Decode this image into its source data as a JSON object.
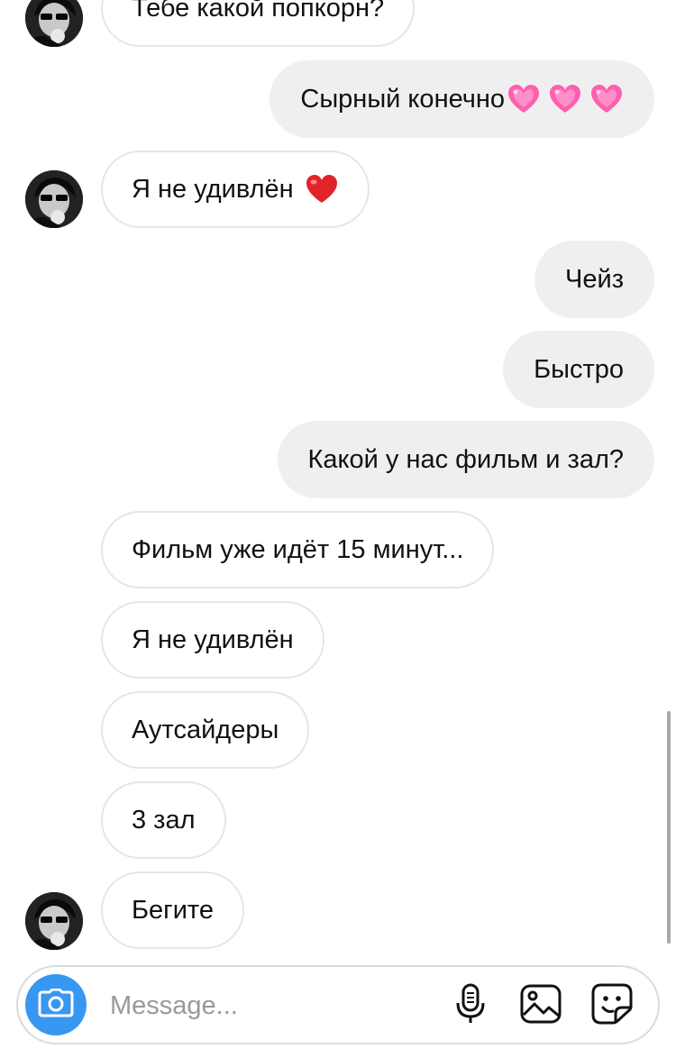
{
  "conversation": {
    "messages": [
      {
        "text": "Тебе какой попкорн?"
      },
      {
        "text": "Сырный конечно"
      },
      {
        "text": "Я не удивлён"
      },
      {
        "text": "Чейз"
      },
      {
        "text": "Быстро"
      },
      {
        "text": "Какой у нас фильм и зал?"
      },
      {
        "text": "Фильм уже идёт 15 минут..."
      },
      {
        "text": "Я не удивлён"
      },
      {
        "text": "Аутсайдеры"
      },
      {
        "text": "3 зал"
      },
      {
        "text": "Бегите"
      }
    ]
  },
  "composer": {
    "placeholder": "Message..."
  },
  "icons": {
    "camera": "camera-icon",
    "microphone": "microphone-icon",
    "gallery": "gallery-icon",
    "sticker": "sticker-icon",
    "pink_heart": "sparkling-heart-emoji",
    "red_heart": "red-heart-emoji"
  },
  "colors": {
    "accent": "#3897f0",
    "outgoing_bubble": "#efefef",
    "incoming_border": "#e6e6e6",
    "pink_heart": "#ff5fae",
    "red_heart": "#e0242a"
  }
}
